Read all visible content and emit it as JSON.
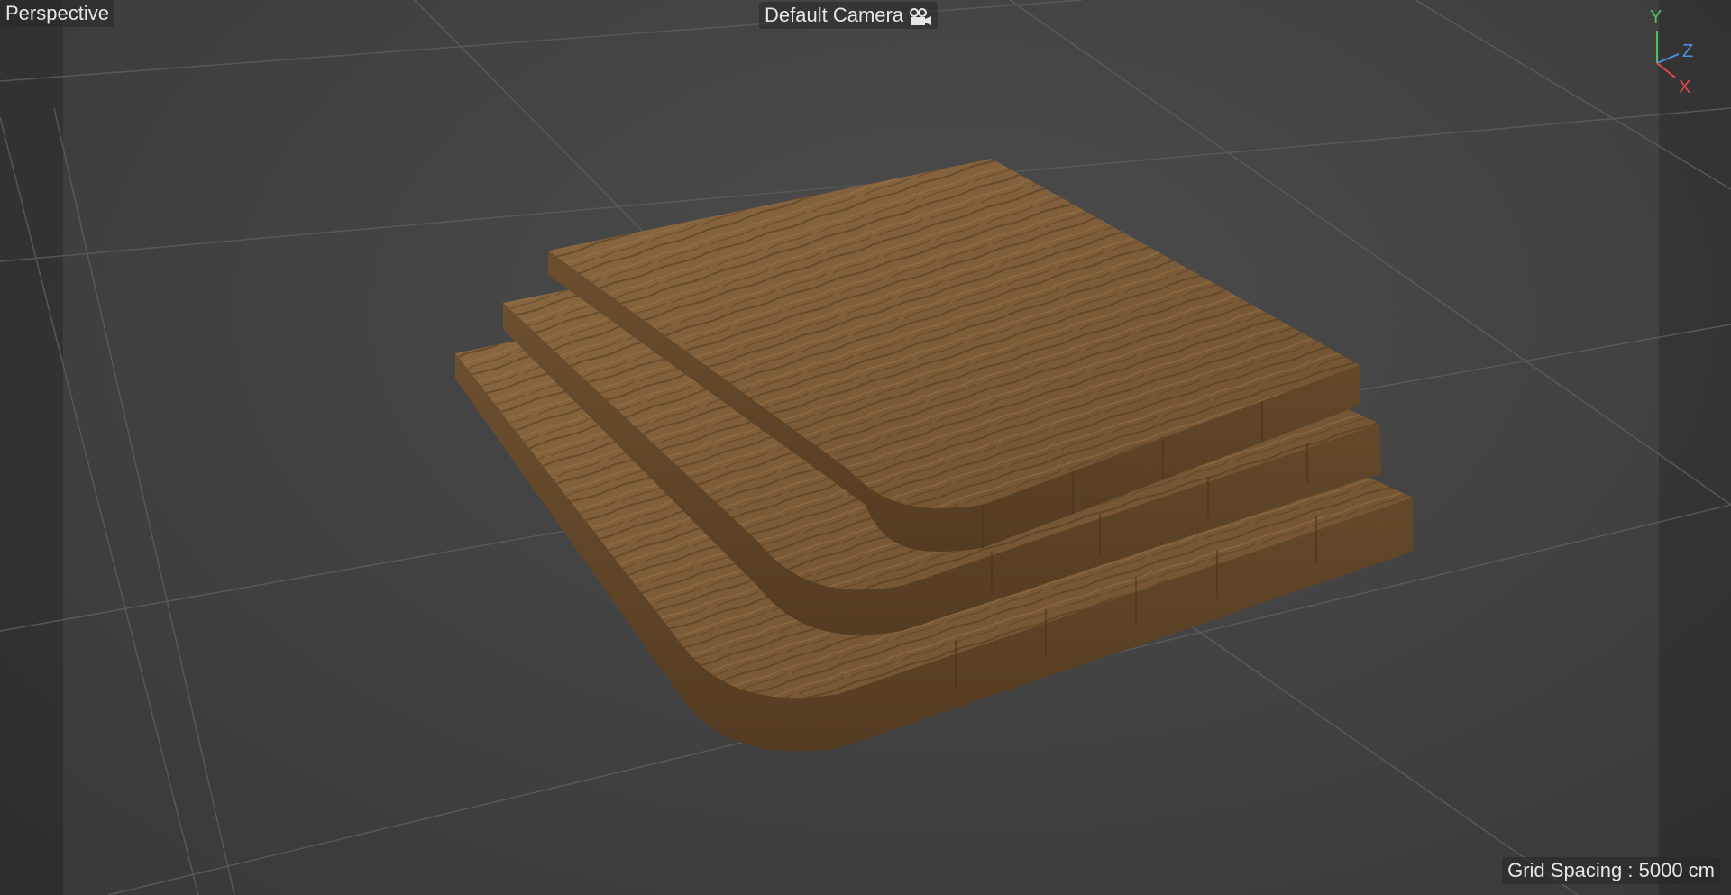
{
  "viewport": {
    "view_mode": "Perspective",
    "camera": "Default Camera",
    "camera_icon": "camera-icon",
    "grid_spacing": "Grid Spacing : 5000 cm"
  },
  "axis_gizmo": {
    "y": {
      "label": "Y",
      "color": "#4fc15a"
    },
    "z": {
      "label": "Z",
      "color": "#4f8fe0"
    },
    "x": {
      "label": "X",
      "color": "#e04848"
    }
  },
  "colors": {
    "background": "#444444",
    "grid_line": "#5a5a5a",
    "wood": "#7a5a38"
  }
}
